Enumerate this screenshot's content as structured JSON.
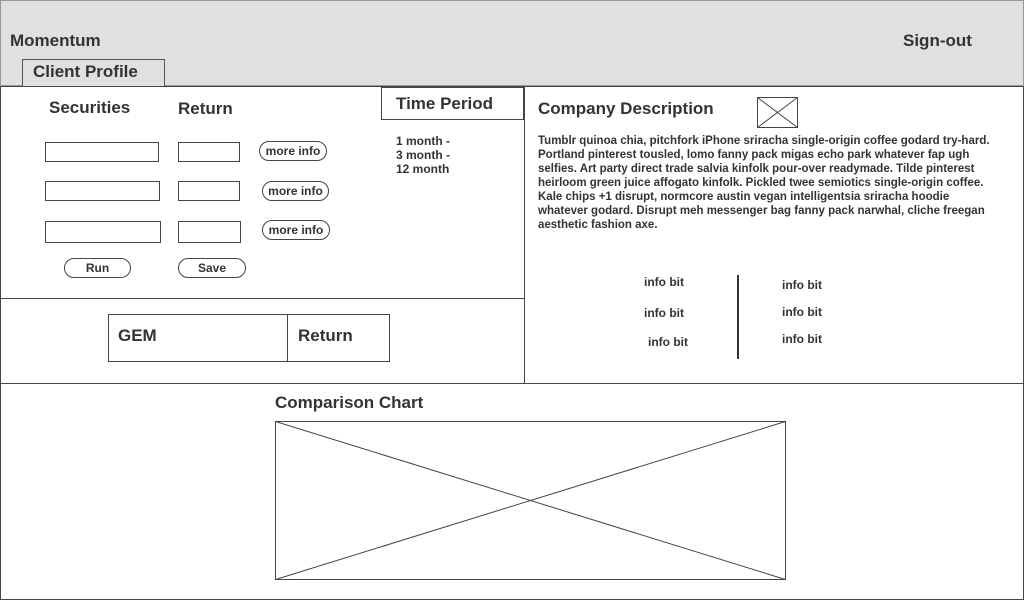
{
  "header": {
    "app_title": "Momentum",
    "sign_out": "Sign-out",
    "tab_label": "Client Profile"
  },
  "securities_panel": {
    "securities_header": "Securities",
    "return_header": "Return",
    "rows": [
      {
        "security": "",
        "return": "",
        "more_info": "more info"
      },
      {
        "security": "",
        "return": "",
        "more_info": "more info"
      },
      {
        "security": "",
        "return": "",
        "more_info": "more info"
      }
    ],
    "run_label": "Run",
    "save_label": "Save"
  },
  "time_period": {
    "title": "Time Period",
    "options": [
      "1 month -",
      "3 month -",
      "12 month"
    ]
  },
  "gem_table": {
    "gem_header": "GEM",
    "return_header": "Return"
  },
  "company": {
    "title": "Company Description",
    "description": "Tumblr quinoa chia, pitchfork iPhone sriracha single-origin coffee godard try-hard. Portland pinterest tousled, lomo fanny pack migas echo park whatever fap ugh selfies. Art party direct trade salvia kinfolk pour-over readymade. Tilde pinterest heirloom green juice affogato kinfolk. Pickled twee semiotics single-origin coffee. Kale chips +1 disrupt, normcore austin vegan intelligentsia sriracha hoodie whatever godard. Disrupt meh messenger bag fanny pack narwhal, cliche freegan aesthetic fashion axe.",
    "info_left": [
      "info bit",
      "info bit",
      "info bit"
    ],
    "info_right": [
      "info bit",
      "info bit",
      "info bit"
    ]
  },
  "comparison": {
    "title": "Comparison Chart"
  }
}
